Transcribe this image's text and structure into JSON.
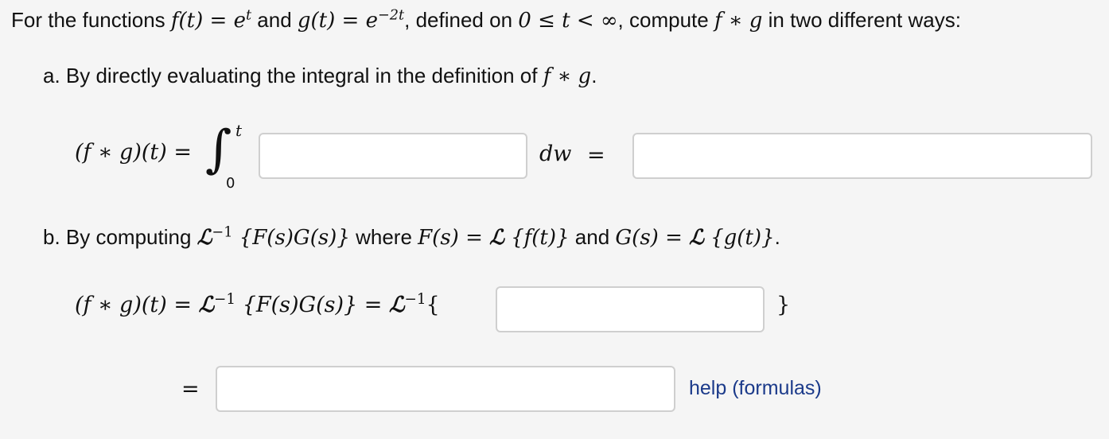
{
  "prompt": {
    "lead": "For the functions ",
    "f_def": "f(t) = e",
    "f_exp": "t",
    "and_word": " and ",
    "g_def": "g(t) = e",
    "g_exp": "−2t",
    "defined": ", defined on ",
    "domain": "0 ≤ t < ∞",
    "compute": ", compute ",
    "conv": "f ∗ g",
    "tail": " in two different ways:"
  },
  "part_a": {
    "label": "a. By directly evaluating the integral in the definition of ",
    "conv": "f ∗ g",
    "period": ".",
    "lhs": "(f ∗ g)(t) =",
    "upper_limit": "t",
    "lower_limit": "0",
    "dw": "dw",
    "equals": "=",
    "integrand_value": "",
    "result_value": ""
  },
  "part_b": {
    "label": "b. By computing ",
    "L": "ℒ",
    "inv_exp": "−1",
    "expr1": " {F(s)G(s)}",
    "where": " where ",
    "F_def": "F(s) = ",
    "f_arg": " {f(t)}",
    "and_word": " and ",
    "G_def": "G(s) = ",
    "g_arg": " {g(t)}",
    "period": ".",
    "lhs": "(f ∗ g)(t) = ",
    "eq_mid": " = ",
    "open_brace": "{",
    "close_brace": "}",
    "equals": "=",
    "transform_value": "",
    "final_value": ""
  },
  "help": {
    "label": "help (formulas)"
  }
}
